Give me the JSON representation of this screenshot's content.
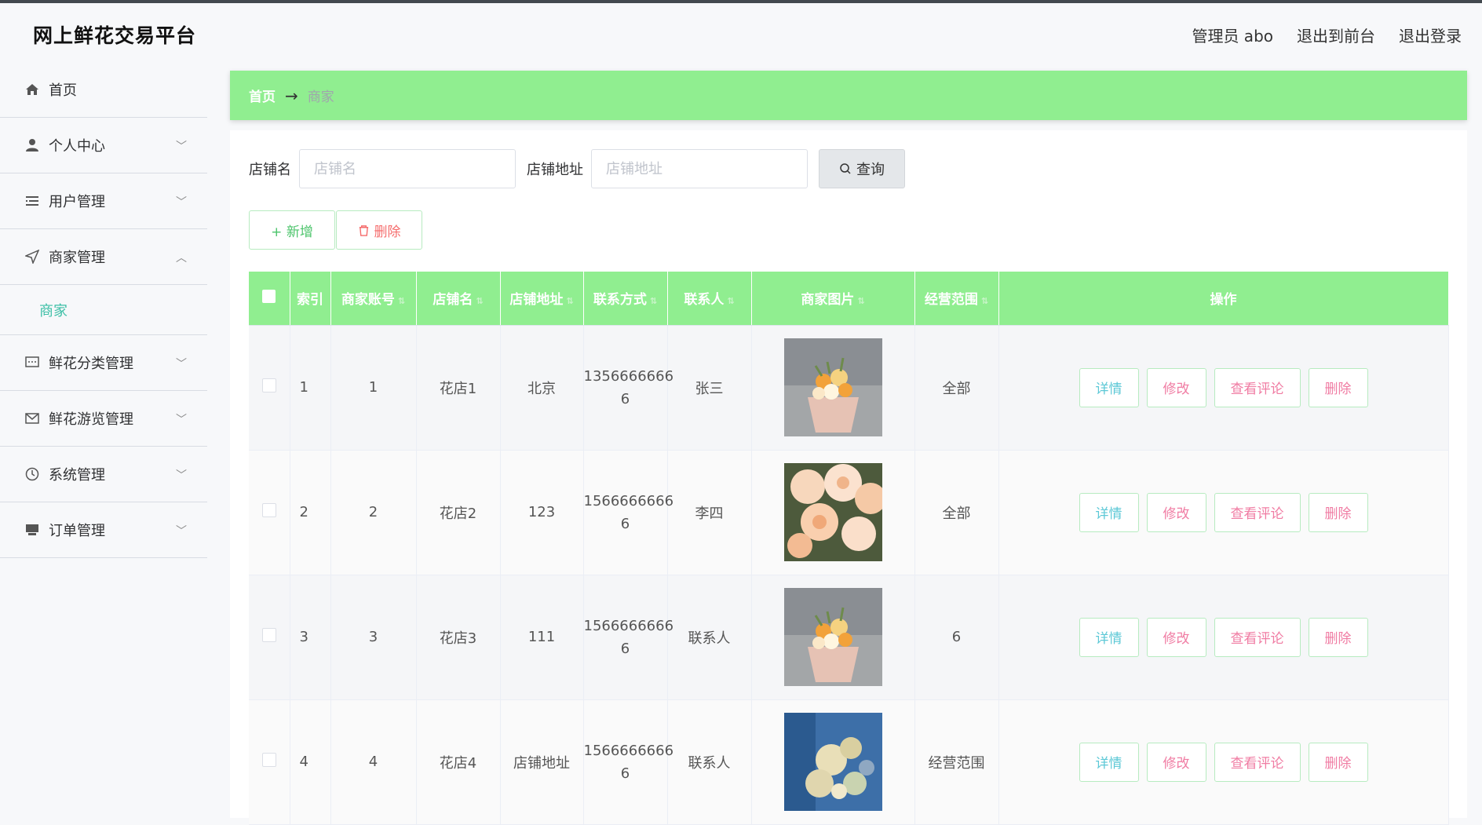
{
  "app": {
    "title": "网上鲜花交易平台",
    "top_links": [
      "管理员 abo",
      "退出到前台",
      "退出登录"
    ]
  },
  "sidebar": {
    "items": [
      {
        "label": "首页",
        "icon": "home-icon"
      },
      {
        "label": "个人中心",
        "icon": "user-icon"
      },
      {
        "label": "用户管理",
        "icon": "list-icon"
      },
      {
        "label": "商家管理",
        "icon": "navigation-icon"
      },
      {
        "label": "鲜花分类管理",
        "icon": "chat-icon"
      },
      {
        "label": "鲜花游览管理",
        "icon": "mail-icon"
      },
      {
        "label": "系统管理",
        "icon": "clock-icon"
      },
      {
        "label": "订单管理",
        "icon": "monitor-icon"
      }
    ],
    "submenu_active": "商家"
  },
  "breadcrumb": {
    "home": "首页",
    "arrow": "→",
    "current": "商家"
  },
  "search": {
    "shop_name_label": "店铺名",
    "shop_name_placeholder": "店铺名",
    "shop_addr_label": "店铺地址",
    "shop_addr_placeholder": "店铺地址",
    "query_label": "查询"
  },
  "actions": {
    "add_label": "+ 新增",
    "delete_label": "删除"
  },
  "table": {
    "headers": [
      "索引",
      "商家账号",
      "店铺名",
      "店铺地址",
      "联系方式",
      "联系人",
      "商家图片",
      "经营范围",
      "操作"
    ],
    "rows": [
      {
        "index": "1",
        "account": "1",
        "shop": "花店1",
        "addr": "北京",
        "phone_a": "1356666666",
        "phone_b": "6",
        "contact": "张三",
        "image": "bouquet-orange",
        "scope": "全部"
      },
      {
        "index": "2",
        "account": "2",
        "shop": "花店2",
        "addr": "123",
        "phone_a": "1566666666",
        "phone_b": "6",
        "contact": "李四",
        "image": "peach-roses",
        "scope": "全部"
      },
      {
        "index": "3",
        "account": "3",
        "shop": "花店3",
        "addr": "111",
        "phone_a": "1566666666",
        "phone_b": "6",
        "contact": "联系人",
        "image": "bouquet-orange",
        "scope": "6"
      },
      {
        "index": "4",
        "account": "4",
        "shop": "花店4",
        "addr": "店铺地址",
        "phone_a": "1566666666",
        "phone_b": "6",
        "contact": "联系人",
        "image": "blue-blossom",
        "scope": "经营范围"
      }
    ],
    "row_ops": [
      "详情",
      "修改",
      "查看评论",
      "删除"
    ]
  },
  "colors": {
    "accent_green": "#90ee90",
    "active_teal": "#3cbfa6",
    "danger": "#f56c6c",
    "edit_pink": "#f07ca3",
    "detail_cyan": "#5cc8d6"
  }
}
